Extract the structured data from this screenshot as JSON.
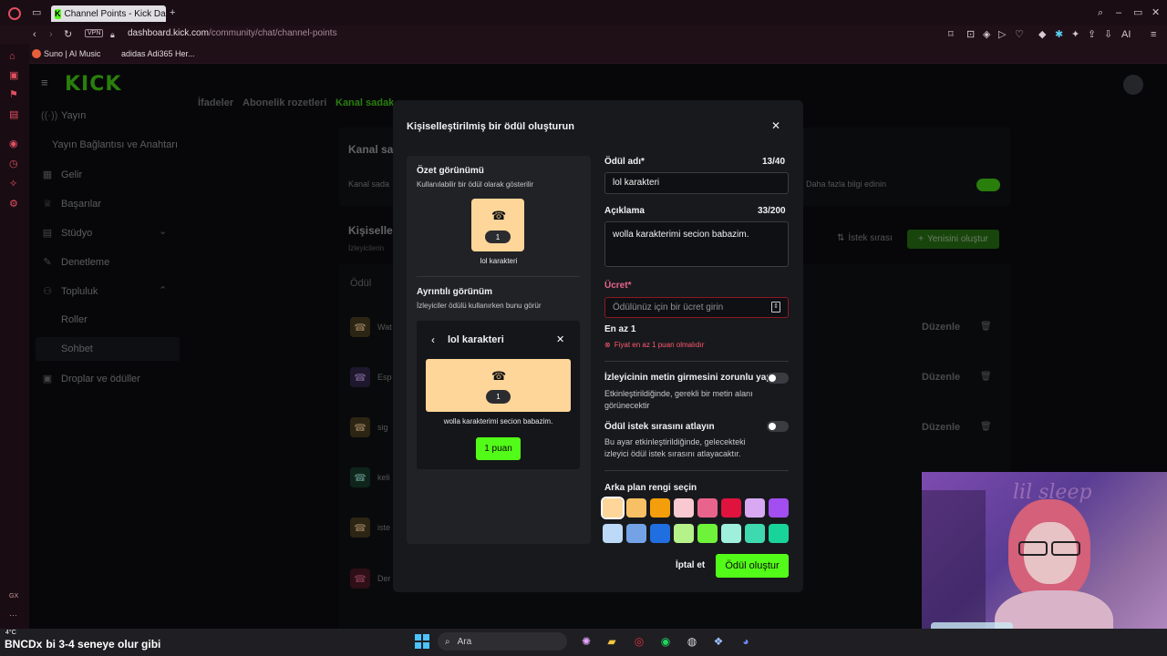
{
  "browser": {
    "tab_title": "Channel Points - Kick Dash",
    "tab_new": "+",
    "vpn_label": "VPN",
    "url_host": "dashboard.kick.com",
    "url_path": "/community/chat/channel-points",
    "bookmarks": [
      "Suno | AI Music",
      "adidas Adi365 Her..."
    ],
    "right_ai": "AI"
  },
  "dashboard": {
    "logo": "KICK",
    "nav": [
      {
        "label": "Yayın",
        "icon": "broadcast-icon"
      },
      {
        "label": "Yayın Bağlantısı ve Anahtarı",
        "icon": ""
      },
      {
        "label": "Gelir",
        "icon": "revenue-icon"
      },
      {
        "label": "Başarılar",
        "icon": "trophy-icon"
      },
      {
        "label": "Stüdyo",
        "icon": "studio-icon"
      },
      {
        "label": "Denetleme",
        "icon": "wrench-icon"
      },
      {
        "label": "Topluluk",
        "icon": "community-icon"
      },
      {
        "label": "Roller",
        "icon": ""
      },
      {
        "label": "Sohbet",
        "icon": ""
      },
      {
        "label": "Droplar ve ödüller",
        "icon": "gift-icon"
      }
    ],
    "bg_tabs": [
      "İfadeler",
      "Abonelik rozetleri",
      "Kanal sadak"
    ],
    "bg_section1_title": "Kanal sa",
    "bg_section1_text": "Kanal sada",
    "bg_learn_more": ". Daha fazla bilgi edinin",
    "bg_section2_title": "Kişiselle",
    "bg_section2_sub": "İzleyicilerin",
    "bg_queue": "İstek sırası",
    "bg_create_new": "Yenisini oluştur",
    "bg_col_reward": "Ödül",
    "bg_rows": [
      "Wat",
      "Esp",
      "sig",
      "keli",
      "iste",
      "Der"
    ],
    "bg_edit": "Düzenle"
  },
  "modal": {
    "title": "Kişiselleştirilmiş bir ödül oluşturun",
    "summary_title": "Özet görünümü",
    "summary_sub": "Kullanılabilir bir ödül olarak gösterilir",
    "cost_badge": "1",
    "reward_name_preview": "lol karakteri",
    "detail_title": "Ayrıntılı görünüm",
    "detail_sub": "İzleyiciler ödülü kullanırken bunu görür",
    "detail_card_title": "lol karakteri",
    "detail_description": "wolla karakterimi secion babazim.",
    "detail_button": "1 puan",
    "form": {
      "name_label": "Ödül adı*",
      "name_count": "13/40",
      "name_value": "lol karakteri",
      "desc_label": "Açıklama",
      "desc_count": "33/200",
      "desc_value": "wolla karakterimi secion babazim.",
      "cost_label": "Ücret*",
      "cost_placeholder": "Ödülünüz için bir ücret girin",
      "min_text": "En az 1",
      "error_text": "Fiyat en az 1 puan olmalıdır",
      "require_input_label": "İzleyicinin metin girmesini zorunlu yap",
      "require_input_desc": "Etkinleştirildiğinde, gerekli bir metin alanı görünecektir",
      "skip_queue_label": "Ödül istek sırasını atlayın",
      "skip_queue_desc": "Bu ayar etkinleştirildiğinde, gelecekteki izleyici ödül istek sırasını atlayacaktır.",
      "bg_color_label": "Arka plan rengi seçin",
      "swatches": [
        "#ffd699",
        "#f7c064",
        "#f59e0b",
        "#f8c9d0",
        "#e9648c",
        "#e0123e",
        "#d8a9f2",
        "#a24ef0",
        "#bcd9f7",
        "#73a3e6",
        "#1f6fe0",
        "#b6f28a",
        "#6ef23a",
        "#9ef0dc",
        "#3fd9b0",
        "#19d49a"
      ],
      "cancel": "İptal et",
      "submit": "Ödül oluştur"
    }
  },
  "stream": {
    "caption": "bi 3-4 seneye olur gibi",
    "brand": "BNCDx",
    "weather": "4°C",
    "search": "Ara",
    "side_label": "GX",
    "dots": "···",
    "webcam_sign": "lil sleep"
  },
  "colors": {
    "kick_green": "#53fc18",
    "card_bg": "#ffd699",
    "error": "#e0123e"
  }
}
